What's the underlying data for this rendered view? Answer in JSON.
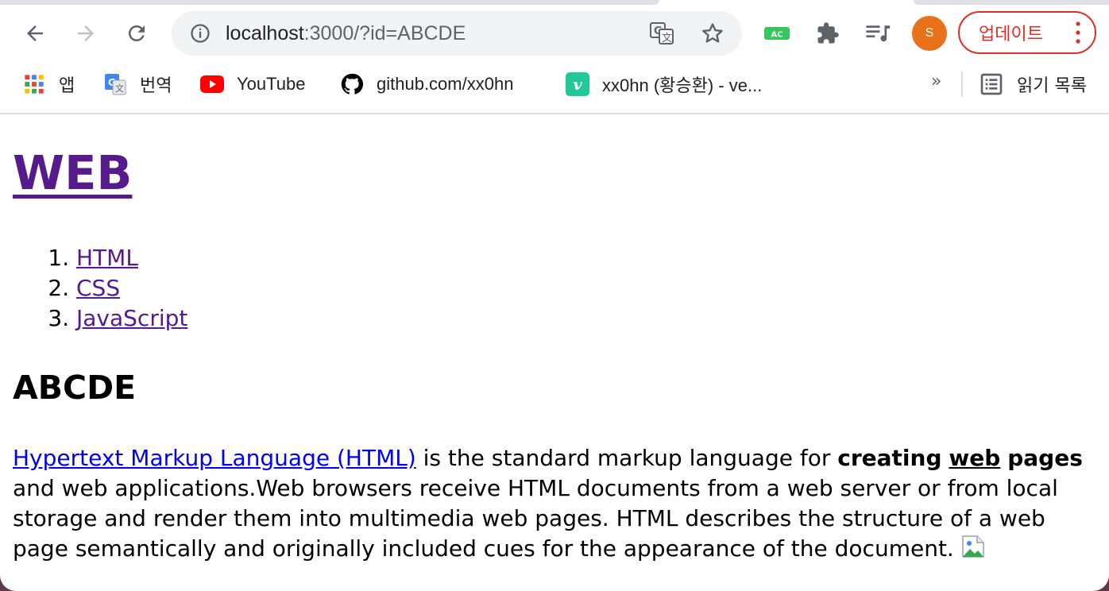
{
  "browser": {
    "url_host": "localhost",
    "url_rest": ":3000/?id=ABCDE",
    "profile_initial": "S",
    "update_label": "업데이트",
    "ext_badge": "AC"
  },
  "bookmarks": [
    {
      "label": "앱",
      "icon": "apps-grid-icon"
    },
    {
      "label": "번역",
      "icon": "google-translate-icon"
    },
    {
      "label": "YouTube",
      "icon": "youtube-icon"
    },
    {
      "label": "github.com/xx0hn",
      "icon": "github-icon"
    },
    {
      "label": "xx0hn (황승환) - ve...",
      "icon": "velog-icon"
    }
  ],
  "bookmarks_overflow": "»",
  "reading_list": "읽기 목록",
  "page": {
    "title": "WEB",
    "nav": [
      "HTML",
      "CSS",
      "JavaScript"
    ],
    "subtitle": "ABCDE",
    "para_link": "Hypertext Markup Language (HTML)",
    "para_1": " is the standard markup language for ",
    "para_bold_1": "creating",
    "para_bold_2": "web",
    "para_bold_3": "pages",
    "para_2": " and web applications.Web browsers receive HTML documents from a web server or from local storage and render them into multimedia web pages. HTML describes the structure of a web page semantically and originally included cues for the appearance of the document."
  },
  "colors": {
    "visited_link": "#551a8b",
    "link": "#0000ee",
    "update_red": "#d93025",
    "avatar_orange": "#e8711a"
  }
}
